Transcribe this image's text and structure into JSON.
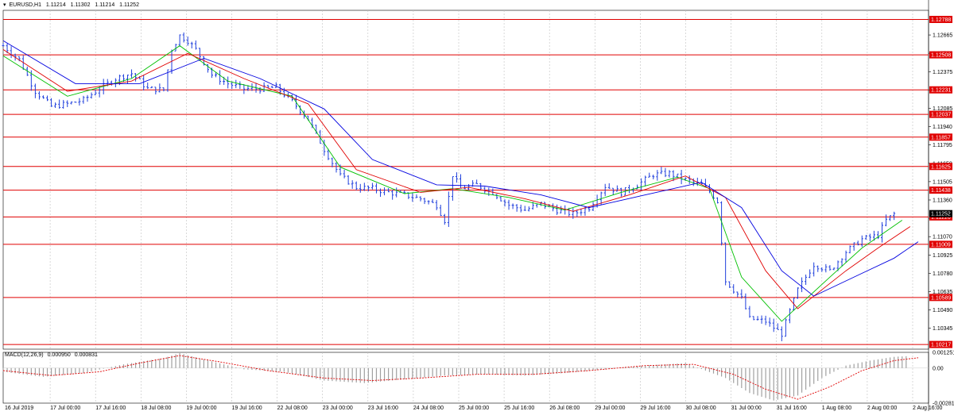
{
  "header": {
    "symbol": "EURUSD,H1",
    "open": "1.11214",
    "high": "1.11302",
    "low": "1.11214",
    "close": "1.11252"
  },
  "macd_header": {
    "label": "MACD(12,26,9)",
    "main": "0.000950",
    "signal": "0.000831"
  },
  "colors": {
    "background": "#ffffff",
    "candle": "#1f3fdc",
    "level_line": "#e00000",
    "level_badge": "#e00000",
    "current_badge": "#000000",
    "ma_fast": "#00c000",
    "ma_mid": "#e00000",
    "ma_slow": "#0000e0",
    "macd_hist": "#a0a0a0",
    "macd_signal": "#e00000",
    "grid": "#c0c0c0"
  },
  "chart_data": [
    {
      "type": "candlestick",
      "title": "EURUSD,H1",
      "ylim": [
        1.1018,
        1.1286
      ],
      "y_ticks": [
        "1.12665",
        "1.12520",
        "1.12375",
        "1.12230",
        "1.12085",
        "1.11940",
        "1.11795",
        "1.11650",
        "1.11505",
        "1.11360",
        "1.11215",
        "1.11070",
        "1.10925",
        "1.10780",
        "1.10635",
        "1.10490",
        "1.10345"
      ],
      "x_ticks": [
        "16 Jul 2019",
        "17 Jul 00:00",
        "17 Jul 16:00",
        "18 Jul 08:00",
        "19 Jul 00:00",
        "19 Jul 16:00",
        "22 Jul 08:00",
        "23 Jul 00:00",
        "23 Jul 16:00",
        "24 Jul 08:00",
        "25 Jul 00:00",
        "25 Jul 16:00",
        "26 Jul 08:00",
        "29 Jul 00:00",
        "29 Jul 16:00",
        "30 Jul 08:00",
        "31 Jul 00:00",
        "31 Jul 16:00",
        "1 Aug 08:00",
        "2 Aug 00:00",
        "2 Aug 16:00"
      ],
      "levels": [
        "1.12788",
        "1.12508",
        "1.12231",
        "1.12037",
        "1.11857",
        "1.11625",
        "1.11438",
        "1.11226",
        "1.11009",
        "1.10589",
        "1.10217"
      ],
      "current_price": "1.11252",
      "price_path": [
        [
          0,
          1.1258
        ],
        [
          4,
          1.1247
        ],
        [
          8,
          1.1222
        ],
        [
          12,
          1.121
        ],
        [
          16,
          1.1212
        ],
        [
          20,
          1.1215
        ],
        [
          24,
          1.1224
        ],
        [
          28,
          1.1232
        ],
        [
          32,
          1.1236
        ],
        [
          36,
          1.1224
        ],
        [
          40,
          1.1223
        ],
        [
          42,
          1.1255
        ],
        [
          44,
          1.1266
        ],
        [
          46,
          1.1262
        ],
        [
          48,
          1.1255
        ],
        [
          52,
          1.1235
        ],
        [
          56,
          1.1228
        ],
        [
          60,
          1.1224
        ],
        [
          64,
          1.1224
        ],
        [
          68,
          1.1225
        ],
        [
          72,
          1.1214
        ],
        [
          76,
          1.12
        ],
        [
          80,
          1.1176
        ],
        [
          84,
          1.1155
        ],
        [
          88,
          1.1146
        ],
        [
          92,
          1.1145
        ],
        [
          96,
          1.1142
        ],
        [
          100,
          1.114
        ],
        [
          104,
          1.1137
        ],
        [
          108,
          1.1132
        ],
        [
          110,
          1.112
        ],
        [
          112,
          1.1156
        ],
        [
          114,
          1.1145
        ],
        [
          118,
          1.1148
        ],
        [
          122,
          1.1142
        ],
        [
          126,
          1.1132
        ],
        [
          130,
          1.1128
        ],
        [
          134,
          1.1133
        ],
        [
          138,
          1.1128
        ],
        [
          142,
          1.1125
        ],
        [
          146,
          1.113
        ],
        [
          150,
          1.1147
        ],
        [
          154,
          1.1142
        ],
        [
          158,
          1.1148
        ],
        [
          162,
          1.1156
        ],
        [
          166,
          1.1157
        ],
        [
          170,
          1.1152
        ],
        [
          174,
          1.1148
        ],
        [
          176,
          1.1143
        ],
        [
          178,
          1.1135
        ],
        [
          180,
          1.1072
        ],
        [
          182,
          1.1065
        ],
        [
          184,
          1.1058
        ],
        [
          186,
          1.1042
        ],
        [
          190,
          1.104
        ],
        [
          194,
          1.103
        ],
        [
          196,
          1.1048
        ],
        [
          198,
          1.1065
        ],
        [
          202,
          1.1085
        ],
        [
          206,
          1.108
        ],
        [
          210,
          1.1095
        ],
        [
          214,
          1.1105
        ],
        [
          218,
          1.1108
        ],
        [
          220,
          1.112
        ],
        [
          222,
          1.1125
        ]
      ],
      "ma_fast": [
        [
          0,
          1.125
        ],
        [
          16,
          1.1218
        ],
        [
          32,
          1.1232
        ],
        [
          44,
          1.1258
        ],
        [
          56,
          1.123
        ],
        [
          72,
          1.1218
        ],
        [
          84,
          1.1162
        ],
        [
          100,
          1.1141
        ],
        [
          112,
          1.1145
        ],
        [
          126,
          1.1138
        ],
        [
          140,
          1.1128
        ],
        [
          154,
          1.1142
        ],
        [
          168,
          1.1154
        ],
        [
          176,
          1.1145
        ],
        [
          184,
          1.1075
        ],
        [
          194,
          1.104
        ],
        [
          206,
          1.1075
        ],
        [
          214,
          1.1098
        ],
        [
          224,
          1.112
        ]
      ],
      "ma_mid": [
        [
          0,
          1.1255
        ],
        [
          16,
          1.1222
        ],
        [
          32,
          1.123
        ],
        [
          46,
          1.1252
        ],
        [
          60,
          1.1232
        ],
        [
          76,
          1.1212
        ],
        [
          88,
          1.116
        ],
        [
          104,
          1.1142
        ],
        [
          116,
          1.1146
        ],
        [
          130,
          1.1137
        ],
        [
          142,
          1.1127
        ],
        [
          156,
          1.114
        ],
        [
          170,
          1.1155
        ],
        [
          180,
          1.1138
        ],
        [
          190,
          1.108
        ],
        [
          198,
          1.105
        ],
        [
          210,
          1.108
        ],
        [
          218,
          1.1098
        ],
        [
          226,
          1.1115
        ]
      ],
      "ma_slow": [
        [
          0,
          1.1262
        ],
        [
          18,
          1.1228
        ],
        [
          34,
          1.1228
        ],
        [
          50,
          1.1248
        ],
        [
          64,
          1.1232
        ],
        [
          80,
          1.1208
        ],
        [
          92,
          1.1168
        ],
        [
          108,
          1.1148
        ],
        [
          120,
          1.1147
        ],
        [
          134,
          1.114
        ],
        [
          146,
          1.113
        ],
        [
          160,
          1.114
        ],
        [
          174,
          1.115
        ],
        [
          184,
          1.113
        ],
        [
          194,
          1.108
        ],
        [
          202,
          1.106
        ],
        [
          214,
          1.1078
        ],
        [
          222,
          1.109
        ],
        [
          228,
          1.1103
        ]
      ]
    },
    {
      "type": "histogram",
      "title": "MACD(12,26,9)",
      "ylim": [
        -0.00281,
        0.00126
      ],
      "y_ticks": [
        "0.001251",
        "0.00",
        "-0.002814"
      ],
      "histogram": [
        [
          0,
          -0.0003
        ],
        [
          10,
          -0.0007
        ],
        [
          20,
          -0.0004
        ],
        [
          30,
          0.0003
        ],
        [
          40,
          0.0008
        ],
        [
          44,
          0.0012
        ],
        [
          50,
          0.0007
        ],
        [
          60,
          -0.0001
        ],
        [
          70,
          -0.0003
        ],
        [
          80,
          -0.001
        ],
        [
          90,
          -0.0012
        ],
        [
          100,
          -0.0009
        ],
        [
          110,
          -0.0006
        ],
        [
          120,
          -0.0005
        ],
        [
          130,
          -0.0006
        ],
        [
          140,
          -0.0004
        ],
        [
          150,
          -0.0001
        ],
        [
          160,
          0.0002
        ],
        [
          170,
          0.0004
        ],
        [
          180,
          -0.0008
        ],
        [
          186,
          -0.002
        ],
        [
          192,
          -0.0026
        ],
        [
          198,
          -0.0022
        ],
        [
          204,
          -0.0008
        ],
        [
          210,
          0.0002
        ],
        [
          216,
          0.0006
        ],
        [
          222,
          0.0009
        ],
        [
          225,
          0.00095
        ]
      ],
      "signal": [
        [
          0,
          -0.0002
        ],
        [
          12,
          -0.0006
        ],
        [
          24,
          -0.0003
        ],
        [
          34,
          0.0004
        ],
        [
          44,
          0.001
        ],
        [
          54,
          0.0005
        ],
        [
          66,
          -0.0002
        ],
        [
          80,
          -0.0008
        ],
        [
          92,
          -0.001
        ],
        [
          104,
          -0.0008
        ],
        [
          118,
          -0.0005
        ],
        [
          132,
          -0.0005
        ],
        [
          146,
          -0.0002
        ],
        [
          160,
          0.0002
        ],
        [
          172,
          0.0003
        ],
        [
          182,
          -0.0005
        ],
        [
          190,
          -0.0017
        ],
        [
          198,
          -0.0025
        ],
        [
          206,
          -0.0015
        ],
        [
          214,
          -0.0002
        ],
        [
          222,
          0.0006
        ],
        [
          228,
          0.00083
        ]
      ]
    }
  ]
}
